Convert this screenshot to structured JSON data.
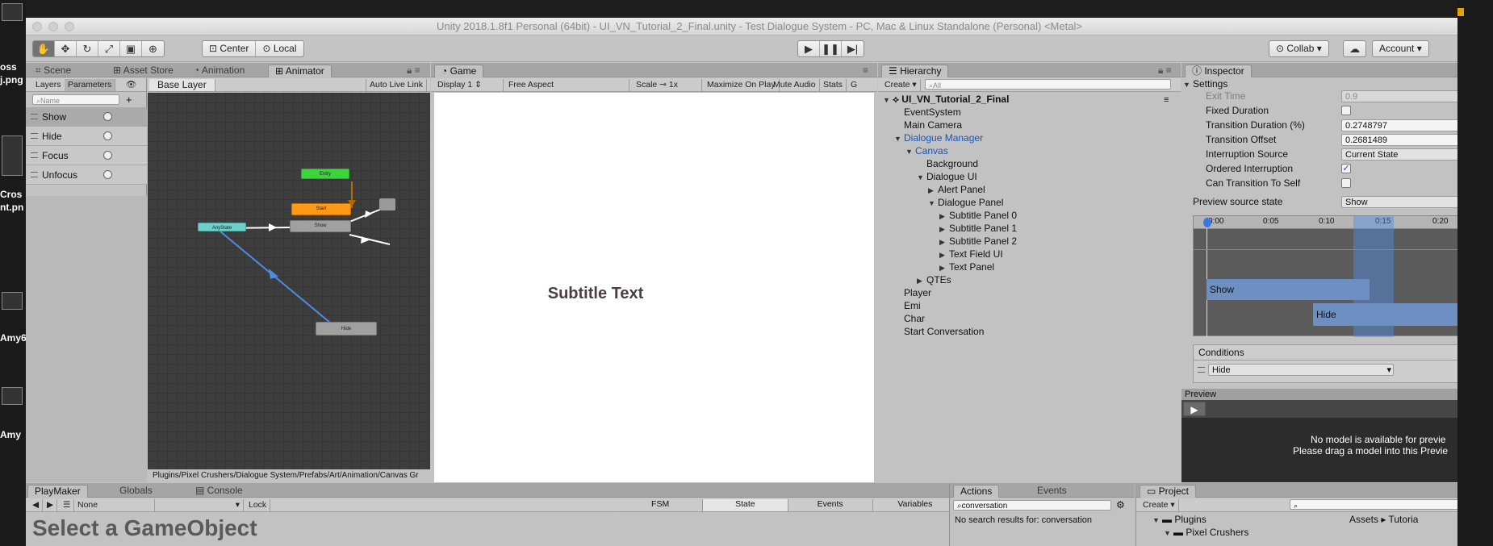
{
  "desktop": {
    "items": [
      "oss",
      "j.png",
      "Cros",
      "nt.pn",
      "Amy6",
      "Amy"
    ]
  },
  "window": {
    "title": "Unity 2018.1.8f1 Personal (64bit) - UI_VN_Tutorial_2_Final.unity - Test Dialogue System - PC, Mac & Linux Standalone (Personal) <Metal>"
  },
  "toolbar": {
    "transform_tools": [
      "hand-icon",
      "move-icon",
      "rotate-icon",
      "scale-icon",
      "rect-icon",
      "transform-icon"
    ],
    "center_label": "Center",
    "local_label": "Local",
    "collab_label": "Collab",
    "account_label": "Account"
  },
  "animator_panel": {
    "tabs": [
      "Scene",
      "Asset Store",
      "Animation",
      "Animator"
    ],
    "sub_tabs": [
      "Layers",
      "Parameters"
    ],
    "search_placeholder": "Name",
    "layer_label": "Base Layer",
    "auto_live_link": "Auto Live Link",
    "parameters": [
      {
        "name": "Show"
      },
      {
        "name": "Hide"
      },
      {
        "name": "Focus"
      },
      {
        "name": "Unfocus"
      }
    ],
    "nodes": {
      "entry": "Entry",
      "start": "Start",
      "show": "Show",
      "any_state": "AnyState",
      "hide": "Hide"
    },
    "footer_path": "Plugins/Pixel Crushers/Dialogue System/Prefabs/Art/Animation/Canvas Gr"
  },
  "game_panel": {
    "tab": "Game",
    "display": "Display 1",
    "aspect": "Free Aspect",
    "scale_label": "Scale",
    "scale_value": "1x",
    "maximize": "Maximize On Play",
    "mute": "Mute Audio",
    "stats": "Stats",
    "gizmos": "G",
    "subtitle_text": "Subtitle Text"
  },
  "hierarchy_panel": {
    "tab": "Hierarchy",
    "create_label": "Create",
    "search_placeholder": "All",
    "scene_name": "UI_VN_Tutorial_2_Final",
    "items": [
      {
        "label": "EventSystem",
        "indent": 0,
        "arrow": "",
        "blue": false
      },
      {
        "label": "Main Camera",
        "indent": 0,
        "arrow": "",
        "blue": false
      },
      {
        "label": "Dialogue Manager",
        "indent": 0,
        "arrow": "▼",
        "blue": true
      },
      {
        "label": "Canvas",
        "indent": 1,
        "arrow": "▼",
        "blue": true
      },
      {
        "label": "Background",
        "indent": 2,
        "arrow": "",
        "blue": false
      },
      {
        "label": "Dialogue UI",
        "indent": 2,
        "arrow": "▼",
        "blue": false
      },
      {
        "label": "Alert Panel",
        "indent": 3,
        "arrow": "▶",
        "blue": false
      },
      {
        "label": "Dialogue Panel",
        "indent": 3,
        "arrow": "▼",
        "blue": false
      },
      {
        "label": "Subtitle Panel 0",
        "indent": 4,
        "arrow": "▶",
        "blue": false
      },
      {
        "label": "Subtitle Panel 1",
        "indent": 4,
        "arrow": "▶",
        "blue": false
      },
      {
        "label": "Subtitle Panel 2",
        "indent": 4,
        "arrow": "▶",
        "blue": false
      },
      {
        "label": "Text Field UI",
        "indent": 4,
        "arrow": "▶",
        "blue": false
      },
      {
        "label": "Text Panel",
        "indent": 4,
        "arrow": "▶",
        "blue": false
      },
      {
        "label": "QTEs",
        "indent": 2,
        "arrow": "▶",
        "blue": false
      },
      {
        "label": "Player",
        "indent": 0,
        "arrow": "",
        "blue": false
      },
      {
        "label": "Emi",
        "indent": 0,
        "arrow": "",
        "blue": false
      },
      {
        "label": "Char",
        "indent": 0,
        "arrow": "",
        "blue": false
      },
      {
        "label": "Start Conversation",
        "indent": 0,
        "arrow": "",
        "blue": false
      }
    ]
  },
  "inspector_panel": {
    "tab": "Inspector",
    "settings_label": "Settings",
    "exit_time_label": "Exit Time",
    "exit_time_value": "0.9",
    "fixed_duration_label": "Fixed Duration",
    "transition_duration_label": "Transition Duration (%)",
    "transition_duration_value": "0.2748797",
    "transition_offset_label": "Transition Offset",
    "transition_offset_value": "0.2681489",
    "interruption_source_label": "Interruption Source",
    "interruption_source_value": "Current State",
    "ordered_interruption_label": "Ordered Interruption",
    "ordered_interruption_checked": true,
    "can_transition_label": "Can Transition To Self",
    "preview_source_label": "Preview source state",
    "preview_source_value": "Show",
    "timeline_ticks": [
      "0:00",
      "0:05",
      "0:10",
      "0:15",
      "0:20"
    ],
    "timeline_show": "Show",
    "timeline_hide": "Hide",
    "conditions_label": "Conditions",
    "condition_value": "Hide",
    "preview_label": "Preview",
    "no_model_line1": "No model is available for previe",
    "no_model_line2": "Please drag a model into this Previe"
  },
  "bottom": {
    "playmaker_tabs": [
      "PlayMaker",
      "Globals",
      "Console"
    ],
    "none_label": "None",
    "lock_label": "Lock",
    "fsm_tabs": [
      "FSM",
      "State",
      "Events",
      "Variables"
    ],
    "select_go": "Select a GameObject",
    "actions_tabs": [
      "Actions",
      "Events"
    ],
    "actions_search": "conversation",
    "no_results": "No search results for: conversation",
    "project_tab": "Project",
    "project_create": "Create",
    "project_tree": [
      "Plugins",
      "Pixel Crushers"
    ],
    "assets_breadcrumb": [
      "Assets",
      "Tutoria"
    ]
  }
}
